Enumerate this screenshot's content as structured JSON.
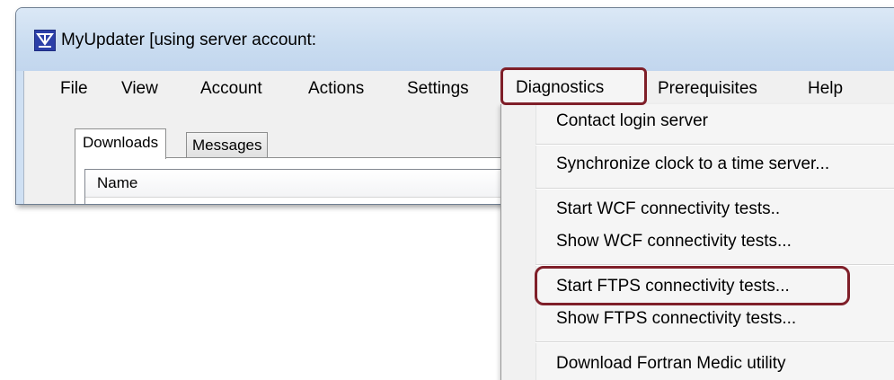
{
  "window": {
    "title": "MyUpdater [using server account:",
    "icon": "download-arrow-icon"
  },
  "menubar": {
    "items": [
      {
        "label": "File"
      },
      {
        "label": "View"
      },
      {
        "label": "Account"
      },
      {
        "label": "Actions"
      },
      {
        "label": "Settings"
      },
      {
        "label": "Diagnostics"
      },
      {
        "label": "Prerequisites"
      },
      {
        "label": "Help"
      }
    ]
  },
  "tabs": [
    {
      "label": "Downloads",
      "active": true
    },
    {
      "label": "Messages",
      "active": false
    }
  ],
  "list": {
    "columns": [
      {
        "label": "Name"
      }
    ]
  },
  "diagnostics_menu": {
    "items": [
      {
        "label": "Contact login server"
      },
      {
        "label": "Synchronize clock to a time server..."
      },
      {
        "label": "Start WCF connectivity tests.."
      },
      {
        "label": "Show WCF connectivity tests..."
      },
      {
        "label": "Start FTPS connectivity tests..."
      },
      {
        "label": "Show FTPS connectivity tests..."
      },
      {
        "label": "Download Fortran Medic utility"
      }
    ]
  },
  "colors": {
    "callout": "#7f1f29",
    "titlebar": "#c9dcf0",
    "menu_background": "#f5f5f5"
  }
}
